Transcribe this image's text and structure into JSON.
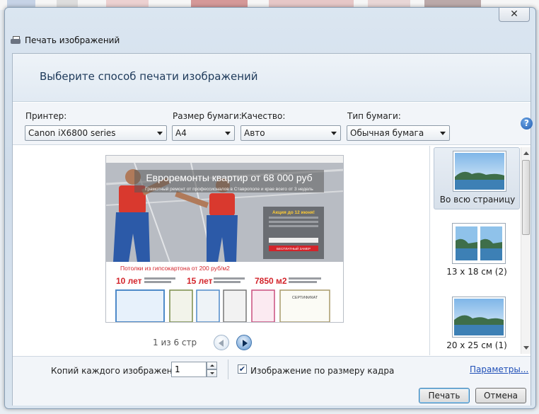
{
  "window": {
    "title": "Печать изображений",
    "close_glyph": "✕"
  },
  "header": {
    "text": "Выберите способ печати изображений"
  },
  "controls": {
    "printer": {
      "label": "Принтер:",
      "value": "Canon iX6800 series"
    },
    "paper_size": {
      "label": "Размер бумаги:",
      "value": "A4"
    },
    "quality": {
      "label": "Качество:",
      "value": "Авто"
    },
    "paper_type": {
      "label": "Тип бумаги:",
      "value": "Обычная бумага"
    },
    "help_glyph": "?"
  },
  "preview": {
    "page_counter": "1 из 6 стр",
    "image": {
      "headline": "Евроремонты квартир от 68 000 руб",
      "subline": "Грамотный ремонт от профессионалов в Ставрополе и крае всего от 3 недель",
      "promo_title": "Акция до 12 июня!",
      "promo_button": "БЕСПЛАТНЫЙ ЗАМЕР",
      "ceiling_text": "Потолки из гипсокартона от 200 руб/м2",
      "stat1": "10 лет",
      "stat2": "15 лет",
      "stat3": "7850 м2",
      "certificate_label": "СЕРТИФИКАТ"
    }
  },
  "layouts": [
    {
      "label": "Во всю страницу",
      "selected": true
    },
    {
      "label": "13 x 18 см (2)",
      "selected": false
    },
    {
      "label": "20 x 25 см (1)",
      "selected": false
    }
  ],
  "bottom": {
    "copies_label": "Копий каждого изображения:",
    "copies_value": "1",
    "fit_label": "Изображение по размеру кадра",
    "fit_checked": true,
    "params_link": "Параметры...",
    "print_button": "Печать",
    "cancel_button": "Отмена"
  },
  "icons": [
    "printer-icon",
    "help-icon",
    "close-icon",
    "prev-page-icon",
    "next-page-icon",
    "checkmark-icon"
  ],
  "colors": {
    "accent": "#1f5bb0",
    "header_text": "#1e3a5a",
    "link": "#1f4fb7"
  }
}
